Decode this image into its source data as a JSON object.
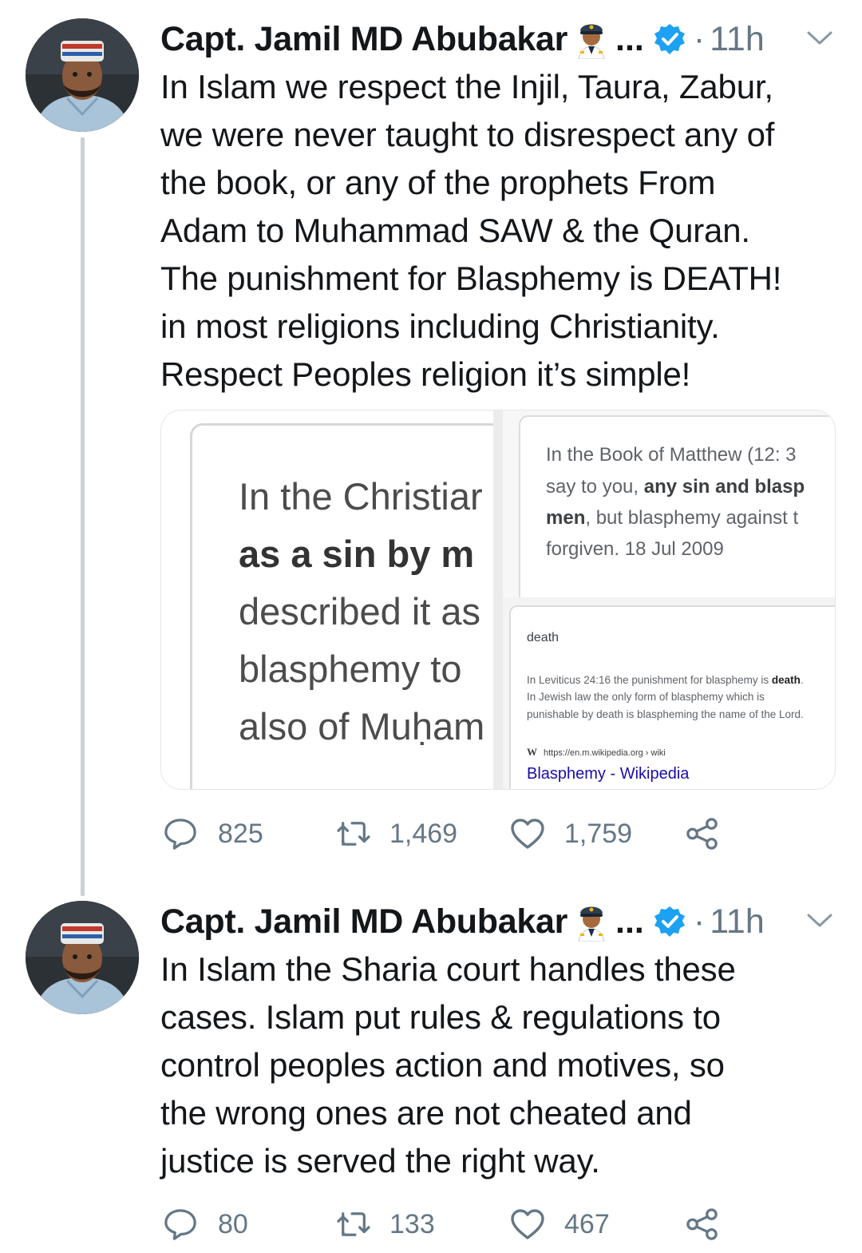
{
  "tweets": [
    {
      "display_name": "Capt. Jamil MD Abubakar",
      "name_emoji": "pilot-emoji",
      "ellipsis": "...",
      "verified": true,
      "dot": "·",
      "timestamp": "11h",
      "text": "In Islam we respect the Injil, Taura, Zabur,\nwe were never taught to disrespect any of\nthe book, or any of the prophets From\nAdam to Muhammad SAW & the Quran.\nThe punishment for Blasphemy is DEATH!\nin most religions including Christianity.\nRespect Peoples religion it’s simple!",
      "media": {
        "left_image": {
          "lines": [
            "In the Christiar",
            "as a sin by m",
            "described it as",
            "blasphemy to",
            "also of Muḥam"
          ]
        },
        "top_right_image": {
          "line1": "In the Book of Matthew (12: 3",
          "line2_pre": "say to you, ",
          "line2_bold": "any sin and blasp",
          "line3_bold": "men",
          "line3_post": ", but blasphemy against t",
          "line4": "forgiven.  18 Jul 2009"
        },
        "bottom_right_image": {
          "title": "death",
          "body_line1_pre": "In Leviticus 24:16 the punishment for blasphemy is ",
          "body_line1_bold": "death",
          "body_line1_post": ".",
          "body_line2": "In Jewish law the only form of blasphemy which is",
          "body_line3": "punishable by death is blaspheming the name of the Lord.",
          "source_logo": "W",
          "source_url": "https://en.m.wikipedia.org › wiki",
          "link_text": "Blasphemy - Wikipedia"
        }
      },
      "actions": {
        "replies": "825",
        "retweets": "1,469",
        "likes": "1,759"
      }
    },
    {
      "display_name": "Capt. Jamil MD Abubakar",
      "name_emoji": "pilot-emoji",
      "ellipsis": "...",
      "verified": true,
      "dot": "·",
      "timestamp": "11h",
      "text": "In Islam the Sharia court handles these\ncases. Islam put rules & regulations to\ncontrol peoples action and motives, so\nthe wrong ones are not cheated and\njustice is served the right way.",
      "actions": {
        "replies": "80",
        "retweets": "133",
        "likes": "467"
      }
    }
  ],
  "colors": {
    "verified_blue": "#1da1f2",
    "muted_text": "#657786",
    "link_blue": "#1a0dab",
    "thread_line": "#c9d1d9"
  }
}
